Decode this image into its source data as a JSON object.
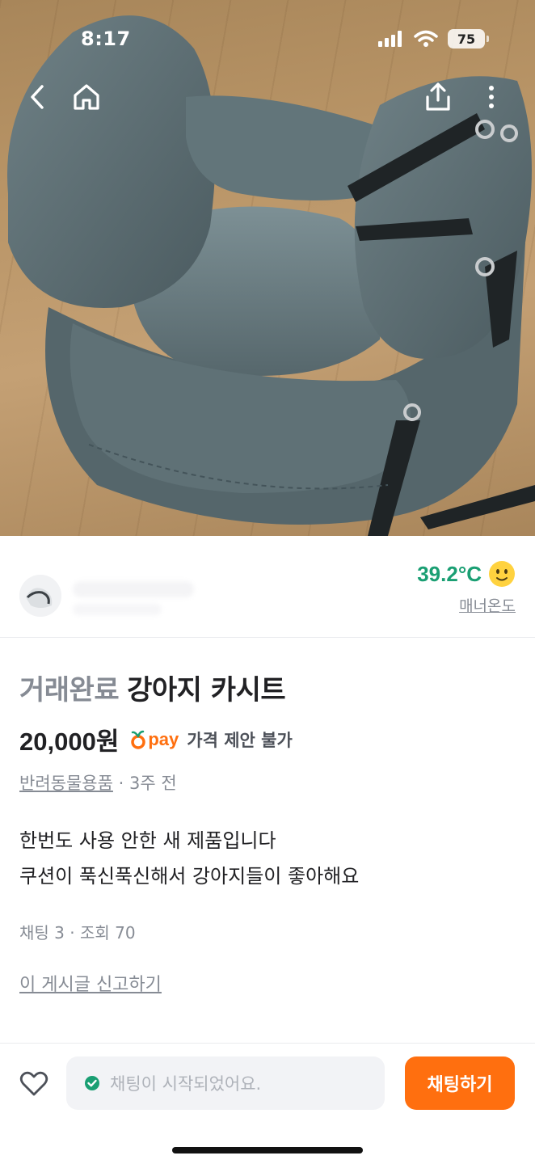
{
  "status_bar": {
    "time": "8:17",
    "battery": "75"
  },
  "nav": {
    "back_icon": "chevron-left-icon",
    "home_icon": "home-icon",
    "share_icon": "share-icon",
    "more_icon": "more-vertical-icon"
  },
  "seller": {
    "manner_temperature": "39.2°C",
    "manner_label": "매너온도"
  },
  "article": {
    "status": "거래완료",
    "title": "강아지 카시트",
    "price": "20,000원",
    "pay_label": "pay",
    "price_offer": "가격 제안 불가",
    "category": "반려동물용품",
    "time_ago": "· 3주 전",
    "description_lines": [
      "한번도 사용 안한 새 제품입니다",
      "쿠션이 푹신푹신해서 강아지들이 좋아해요"
    ],
    "stats": "채팅 3 · 조회 70",
    "report_link": "이 게시글 신고하기"
  },
  "bottom_bar": {
    "chat_status": "채팅이 시작되었어요.",
    "chat_button": "채팅하기"
  },
  "colors": {
    "accent_orange": "#ff6f0f",
    "temperature_green": "#1a9f73",
    "muted_gray": "#868b94"
  }
}
